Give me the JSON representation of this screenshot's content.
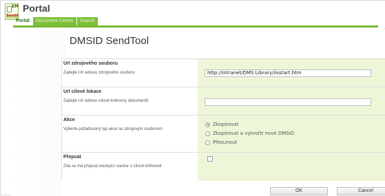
{
  "app": {
    "title": "Portal",
    "logo_text": "EM",
    "logo_sub": "Sendit"
  },
  "tabs": [
    {
      "label": "Portal",
      "active": true
    },
    {
      "label": "Document Center",
      "active": false
    },
    {
      "label": "Search",
      "active": false
    }
  ],
  "page": {
    "title": "DMSID SendTool"
  },
  "form": {
    "source": {
      "title": "Url zdrojového souboru",
      "desc": "Zadejte Url adresu zdrojového souboru",
      "value": "http://intranet/DMS Library/iisstart.htm"
    },
    "target": {
      "title": "Url cílové lokace",
      "desc": "Zadejte Url adresu cílové knihovny dokumentů",
      "value": ""
    },
    "action": {
      "title": "Akce",
      "desc": "Vyberte požadovaný typ akce se zdrojovým souborem",
      "options": [
        "Zkopírovat",
        "Zkopírovat a vytvořit nové DMSID",
        "Přesunout"
      ],
      "selected": "Zkopírovat"
    },
    "overwrite": {
      "title": "Přepsat",
      "desc": "Zda se má přepsat existující soubor v cílové knihovně",
      "checked": false
    }
  },
  "buttons": {
    "ok": "OK",
    "cancel": "Cancel"
  },
  "colors": {
    "accent": "#78b832",
    "value_bg": "#eef6d8"
  }
}
